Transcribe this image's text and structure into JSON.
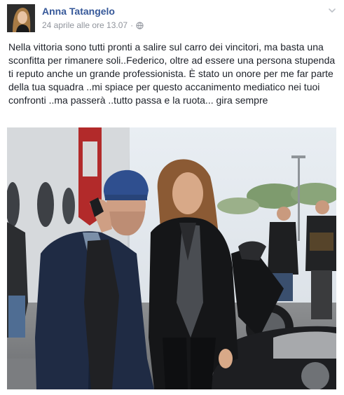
{
  "post": {
    "author": "Anna Tatangelo",
    "timestamp": "24 aprile alle ore 13.07",
    "separator": "·",
    "text": "Nella vittoria sono tutti pronti a salire sul carro dei vincitori, ma basta una sconfitta per rimanere soli..Federico, oltre ad essere una persona stupenda ti reputo anche un grande professionista. È stato un onore per me far parte della tua squadra ..mi spiace per questo accanimento mediatico nei tuoi confronti ..ma passerà ..tutto passa e la ruota... gira sempre"
  },
  "icons": {
    "privacy": "globe-icon",
    "options": "chevron-down-icon"
  },
  "colors": {
    "author_link": "#365899",
    "meta_text": "#90949c",
    "body_text": "#1d2129"
  }
}
